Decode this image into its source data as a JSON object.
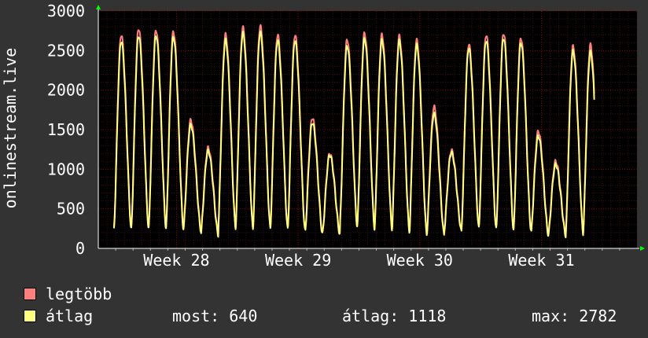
{
  "chart_data": {
    "type": "line",
    "ylabel": "onlinestream.live",
    "ylim": [
      0,
      3000
    ],
    "yticks": [
      0,
      500,
      1000,
      1500,
      2000,
      2500,
      3000
    ],
    "xticks": [
      "Week 28",
      "Week 29",
      "Week 30",
      "Week 31"
    ],
    "xrange_days": [
      0,
      31
    ],
    "week_tick_days": [
      4.5,
      11.5,
      18.5,
      25.5
    ],
    "grid": true,
    "colors": {
      "background": "#333333",
      "plot_background": "#000000",
      "grid": "#8B0000",
      "max_line": "#FF7F7F",
      "avg_line": "#FFFF80",
      "axis_arrow": "#00FF00"
    },
    "series": [
      {
        "name": "legtöbb",
        "color": "#FF7F7F",
        "daily_peaks": [
          2700,
          2780,
          2760,
          2740,
          1620,
          1270,
          2700,
          2790,
          2810,
          2700,
          2700,
          1650,
          1200,
          2640,
          2720,
          2700,
          2680,
          2630,
          1790,
          1240,
          2580,
          2700,
          2720,
          2660,
          1480,
          1100,
          2550,
          2570
        ],
        "daily_mins": [
          250,
          260,
          270,
          270,
          250,
          190,
          280,
          270,
          270,
          260,
          240,
          200,
          200,
          300,
          270,
          270,
          240,
          200,
          190,
          230,
          270,
          260,
          240,
          250,
          190,
          180,
          210
        ]
      },
      {
        "name": "átlag",
        "color": "#FFFF80",
        "daily_peaks": [
          2620,
          2690,
          2690,
          2670,
          1560,
          1230,
          2630,
          2720,
          2730,
          2630,
          2630,
          1590,
          1180,
          2560,
          2650,
          2630,
          2620,
          2570,
          1700,
          1210,
          2530,
          2630,
          2660,
          2600,
          1420,
          1060,
          2490,
          2480
        ],
        "daily_mins": [
          230,
          240,
          250,
          250,
          230,
          170,
          260,
          250,
          250,
          240,
          220,
          180,
          180,
          280,
          250,
          250,
          220,
          180,
          170,
          210,
          250,
          240,
          220,
          230,
          170,
          160,
          190
        ]
      }
    ]
  },
  "legend": {
    "max_label": "legtöbb",
    "avg_label": "átlag"
  },
  "stats": {
    "now_label": "most: 640",
    "avg_label": "átlag: 1118",
    "max_label": "max: 2782"
  }
}
